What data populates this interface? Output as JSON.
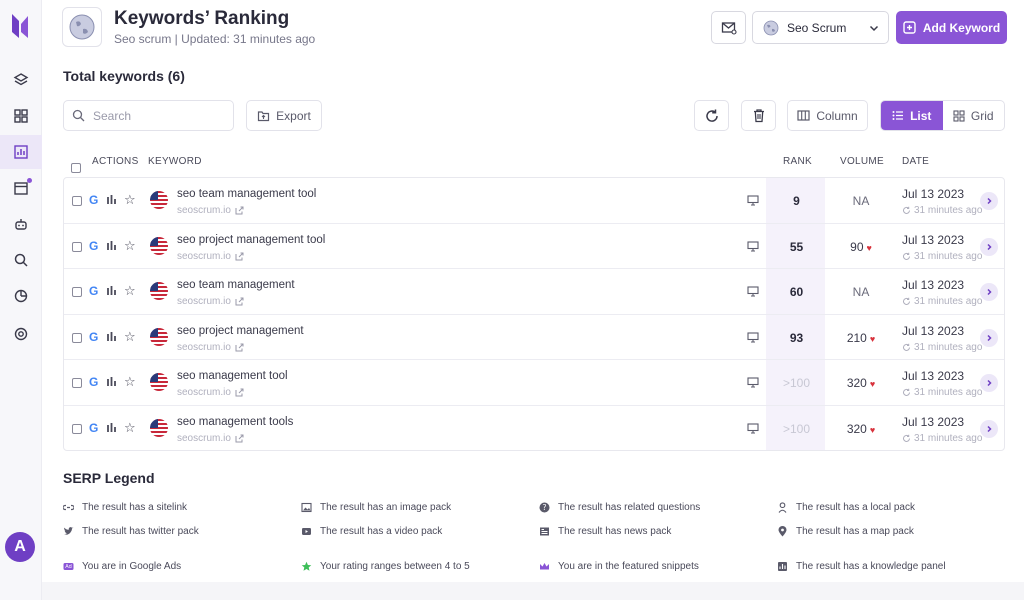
{
  "header": {
    "title": "Keywords’ Ranking",
    "subtitle": "Seo scrum | Updated: 31 minutes ago",
    "project_select": "Seo Scrum",
    "add_button": "Add Keyword"
  },
  "total_label": "Total keywords (6)",
  "toolbar": {
    "search_placeholder": "Search",
    "export_label": "Export",
    "column_label": "Column",
    "list_label": "List",
    "grid_label": "Grid"
  },
  "table": {
    "headers": {
      "actions": "ACTIONS",
      "keyword": "KEYWORD",
      "rank": "RANK",
      "volume": "VOLUME",
      "date": "DATE"
    },
    "rows": [
      {
        "keyword": "seo team management tool",
        "domain": "seoscrum.io",
        "rank": "9",
        "volume": "NA",
        "date": "Jul 13 2023",
        "ago": "31 minutes ago"
      },
      {
        "keyword": "seo project management tool",
        "domain": "seoscrum.io",
        "rank": "55",
        "volume": "90",
        "date": "Jul 13 2023",
        "ago": "31 minutes ago"
      },
      {
        "keyword": "seo team management",
        "domain": "seoscrum.io",
        "rank": "60",
        "volume": "NA",
        "date": "Jul 13 2023",
        "ago": "31 minutes ago"
      },
      {
        "keyword": "seo project management",
        "domain": "seoscrum.io",
        "rank": "93",
        "volume": "210",
        "date": "Jul 13 2023",
        "ago": "31 minutes ago"
      },
      {
        "keyword": "seo management tool",
        "domain": "seoscrum.io",
        "rank": ">100",
        "volume": "320",
        "date": "Jul 13 2023",
        "ago": "31 minutes ago"
      },
      {
        "keyword": "seo management tools",
        "domain": "seoscrum.io",
        "rank": ">100",
        "volume": "320",
        "date": "Jul 13 2023",
        "ago": "31 minutes ago"
      }
    ]
  },
  "legend": {
    "title": "SERP Legend",
    "items": [
      {
        "icon": "link-icon",
        "text": "The result has a sitelink"
      },
      {
        "icon": "image-icon",
        "text": "The result has an image pack"
      },
      {
        "icon": "question-icon",
        "text": "The result has related questions"
      },
      {
        "icon": "location-icon",
        "text": "The result has a local pack"
      },
      {
        "icon": "twitter-icon",
        "text": "The result has twitter pack"
      },
      {
        "icon": "video-icon",
        "text": "The result has a video pack"
      },
      {
        "icon": "news-icon",
        "text": "The result has news pack"
      },
      {
        "icon": "map-pin-icon",
        "text": "The result has a map pack"
      },
      {
        "icon": "ads-icon",
        "text": "You are in Google Ads"
      },
      {
        "icon": "star-icon",
        "text": "Your rating ranges between 4 to 5"
      },
      {
        "icon": "crown-icon",
        "text": "You are in the featured snippets"
      },
      {
        "icon": "knowledge-icon",
        "text": "The result has a knowledge panel"
      }
    ]
  },
  "sidebar": {
    "avatar_letter": "A"
  },
  "colors": {
    "accent": "#8a55d6",
    "heart": "#d8323c",
    "rank_band": "#f5f2fb"
  }
}
